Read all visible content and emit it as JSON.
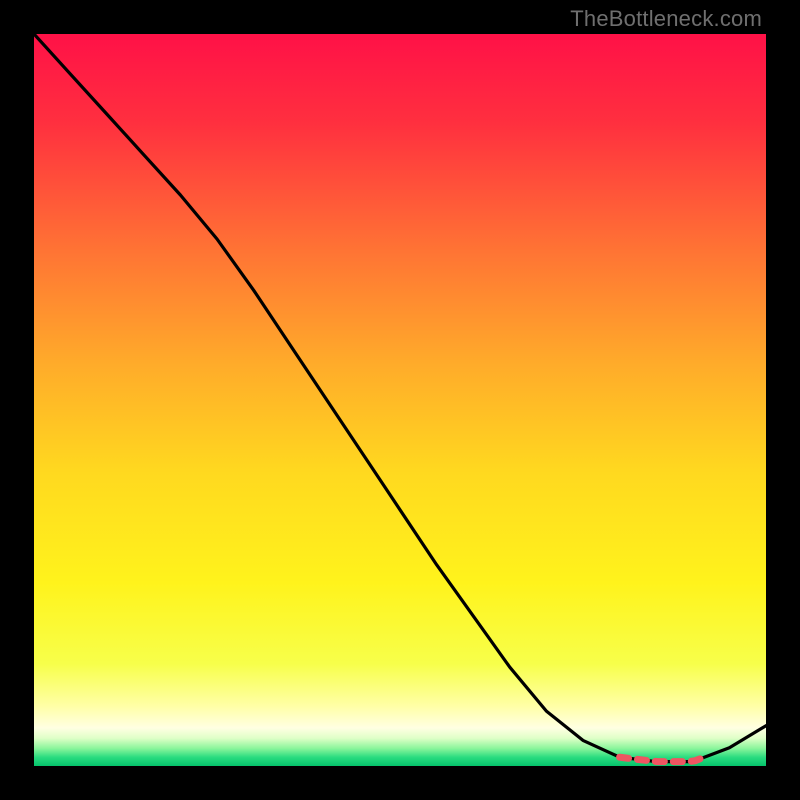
{
  "watermark": "TheBottleneck.com",
  "chart_data": {
    "type": "line",
    "title": "",
    "xlabel": "",
    "ylabel": "",
    "x": [
      0.0,
      0.05,
      0.1,
      0.15,
      0.2,
      0.25,
      0.3,
      0.35,
      0.4,
      0.45,
      0.5,
      0.55,
      0.6,
      0.65,
      0.7,
      0.75,
      0.8,
      0.85,
      0.9,
      0.95,
      1.0
    ],
    "values": [
      1.0,
      0.945,
      0.89,
      0.835,
      0.78,
      0.72,
      0.65,
      0.575,
      0.5,
      0.425,
      0.35,
      0.275,
      0.205,
      0.135,
      0.075,
      0.035,
      0.012,
      0.006,
      0.006,
      0.025,
      0.055
    ],
    "xlim": [
      0,
      1
    ],
    "ylim": [
      0,
      1
    ],
    "highlight_segment": {
      "x_start": 0.8,
      "x_end": 0.92
    },
    "gradient_stops": [
      {
        "offset": 0.0,
        "color": "#ff1147"
      },
      {
        "offset": 0.12,
        "color": "#ff2f3f"
      },
      {
        "offset": 0.3,
        "color": "#ff7534"
      },
      {
        "offset": 0.45,
        "color": "#ffab2a"
      },
      {
        "offset": 0.6,
        "color": "#ffd91f"
      },
      {
        "offset": 0.75,
        "color": "#fff31c"
      },
      {
        "offset": 0.86,
        "color": "#f7ff4a"
      },
      {
        "offset": 0.918,
        "color": "#ffffa6"
      },
      {
        "offset": 0.948,
        "color": "#ffffe2"
      },
      {
        "offset": 0.962,
        "color": "#dfffc7"
      },
      {
        "offset": 0.976,
        "color": "#8af59b"
      },
      {
        "offset": 0.988,
        "color": "#2adc80"
      },
      {
        "offset": 1.0,
        "color": "#05c36b"
      }
    ]
  }
}
